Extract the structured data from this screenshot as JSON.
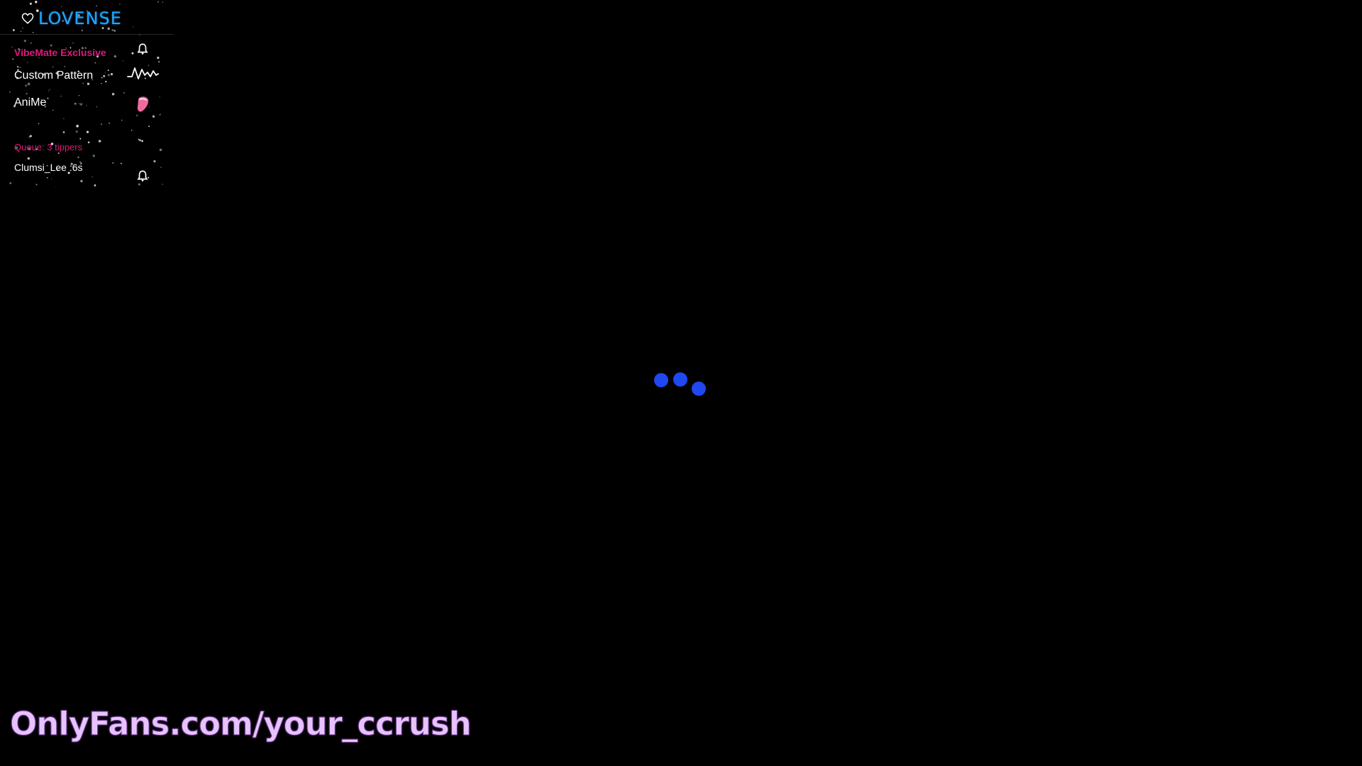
{
  "lovense_panel": {
    "logo_text": "LOVENSE",
    "exclusive_label": "VibeMate Exclusive",
    "custom_pattern_label": "Custom Pattern",
    "anime_label": "AniMe",
    "queue_label": "Queue: 3 tippers",
    "queue_user": "Clumsi_Lee :6s",
    "icons": {
      "logo": "heart-icon",
      "exclusive": "bell-icon",
      "custom_pattern": "wave-icon",
      "anime": "tongue-icon",
      "queue_user": "bell-icon"
    },
    "colors": {
      "logo": "#1fa8ff",
      "exclusive": "#e0187a",
      "queue": "#e0187a",
      "icon_pink": "#f06aa0"
    }
  },
  "loading": {
    "dot_color": "#1f48f0"
  },
  "watermark": {
    "text": "OnlyFans.com/your_ccrush",
    "color": "#e8c2ff"
  },
  "background": "#000000"
}
